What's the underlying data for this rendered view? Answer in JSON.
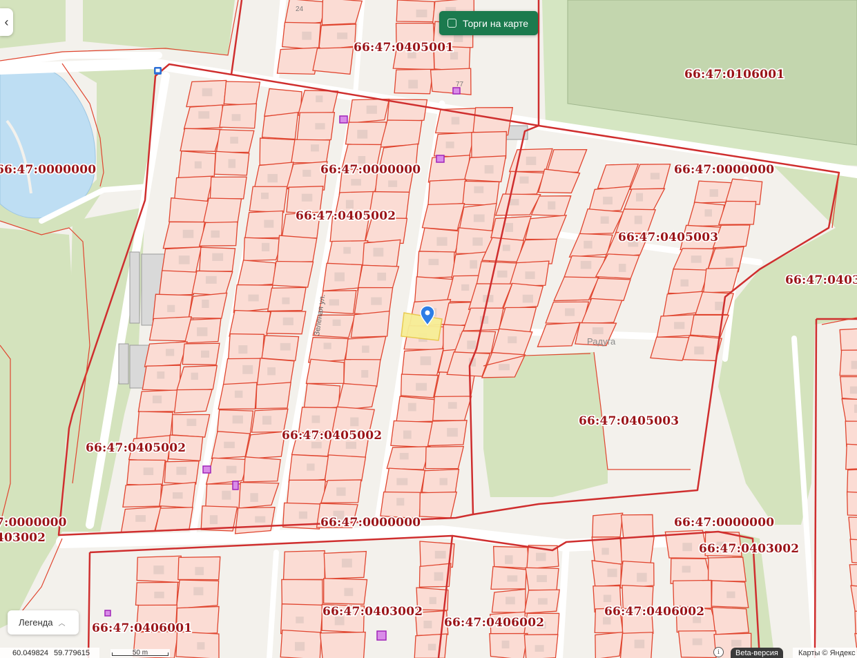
{
  "toolbar": {
    "back_icon": "chevron-left-icon",
    "torgi_label": "Торги на карте",
    "legend_label": "Легенда"
  },
  "labels": {
    "l1": "66:47:0405001",
    "l2": "66:47:0106001",
    "l3": "66:47:0000000",
    "l4": "66:47:0000000",
    "l5": "66:47:0000000",
    "l6": "66:47:0405002",
    "l7": "66:47:0405003",
    "l8": "66:47:0403",
    "l9": "66:47:0405003",
    "l10": "66:47:0405002",
    "l11": "66:47:0405002",
    "l12": "7:0000000",
    "l13": "403002",
    "l14": "66:47:0000000",
    "l15": "66:47:0000000",
    "l16": "66:47:0403002",
    "l17": "66:47:0403002",
    "l18": "66:47:0406002",
    "l19": "66:47:0406002",
    "l20": "66:47:0406001"
  },
  "streets": {
    "zelenaya": "Зеленая ул.",
    "raduga": "Радуга"
  },
  "house_numbers": {
    "h24": "24",
    "h77": "77"
  },
  "status": {
    "lat": "60.049824",
    "lon": "59.779615",
    "scale": "50 m",
    "info": "i",
    "beta": "Beta-версия",
    "attribution": "Карты © Яндекс"
  },
  "colors": {
    "parcel_fill": "#fbdcd4",
    "parcel_stroke": "#e0452f",
    "block_border": "#cf2e2e",
    "green": "#d3e3bc",
    "field": "#c5d7b0",
    "water": "#bedef3",
    "selected": "#f7ee96",
    "marker": "#2d7ee6",
    "accent_button": "#1b7a4e"
  }
}
